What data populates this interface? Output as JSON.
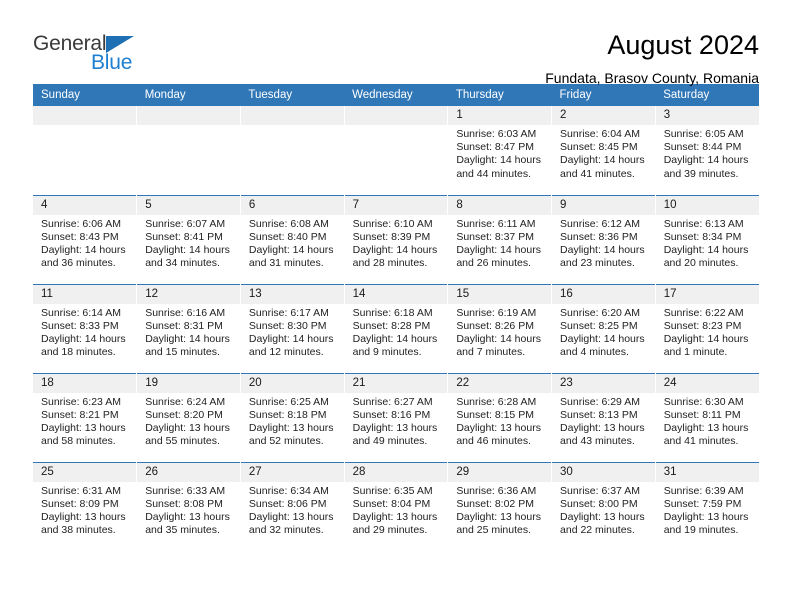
{
  "logo": {
    "word_one": "General",
    "word_two": "Blue",
    "triangle": "blue-triangle-icon",
    "accent_dark": "#3b3b3b",
    "accent_blue": "#1f7fd0"
  },
  "header": {
    "title": "August 2024",
    "subtitle": "Fundata, Brasov County, Romania"
  },
  "theme": {
    "header_band": "#3077b8",
    "daynum_strip": "#f0f0f0",
    "grid_line": "#3077b8",
    "text": "#000000"
  },
  "weekday_headers": [
    "Sunday",
    "Monday",
    "Tuesday",
    "Wednesday",
    "Thursday",
    "Friday",
    "Saturday"
  ],
  "weeks": [
    [
      {
        "day": "",
        "empty": true
      },
      {
        "day": "",
        "empty": true
      },
      {
        "day": "",
        "empty": true
      },
      {
        "day": "",
        "empty": true
      },
      {
        "day": "1",
        "sunrise": "Sunrise: 6:03 AM",
        "sunset": "Sunset: 8:47 PM",
        "daylight_1": "Daylight: 14 hours",
        "daylight_2": "and 44 minutes."
      },
      {
        "day": "2",
        "sunrise": "Sunrise: 6:04 AM",
        "sunset": "Sunset: 8:45 PM",
        "daylight_1": "Daylight: 14 hours",
        "daylight_2": "and 41 minutes."
      },
      {
        "day": "3",
        "sunrise": "Sunrise: 6:05 AM",
        "sunset": "Sunset: 8:44 PM",
        "daylight_1": "Daylight: 14 hours",
        "daylight_2": "and 39 minutes."
      }
    ],
    [
      {
        "day": "4",
        "sunrise": "Sunrise: 6:06 AM",
        "sunset": "Sunset: 8:43 PM",
        "daylight_1": "Daylight: 14 hours",
        "daylight_2": "and 36 minutes."
      },
      {
        "day": "5",
        "sunrise": "Sunrise: 6:07 AM",
        "sunset": "Sunset: 8:41 PM",
        "daylight_1": "Daylight: 14 hours",
        "daylight_2": "and 34 minutes."
      },
      {
        "day": "6",
        "sunrise": "Sunrise: 6:08 AM",
        "sunset": "Sunset: 8:40 PM",
        "daylight_1": "Daylight: 14 hours",
        "daylight_2": "and 31 minutes."
      },
      {
        "day": "7",
        "sunrise": "Sunrise: 6:10 AM",
        "sunset": "Sunset: 8:39 PM",
        "daylight_1": "Daylight: 14 hours",
        "daylight_2": "and 28 minutes."
      },
      {
        "day": "8",
        "sunrise": "Sunrise: 6:11 AM",
        "sunset": "Sunset: 8:37 PM",
        "daylight_1": "Daylight: 14 hours",
        "daylight_2": "and 26 minutes."
      },
      {
        "day": "9",
        "sunrise": "Sunrise: 6:12 AM",
        "sunset": "Sunset: 8:36 PM",
        "daylight_1": "Daylight: 14 hours",
        "daylight_2": "and 23 minutes."
      },
      {
        "day": "10",
        "sunrise": "Sunrise: 6:13 AM",
        "sunset": "Sunset: 8:34 PM",
        "daylight_1": "Daylight: 14 hours",
        "daylight_2": "and 20 minutes."
      }
    ],
    [
      {
        "day": "11",
        "sunrise": "Sunrise: 6:14 AM",
        "sunset": "Sunset: 8:33 PM",
        "daylight_1": "Daylight: 14 hours",
        "daylight_2": "and 18 minutes."
      },
      {
        "day": "12",
        "sunrise": "Sunrise: 6:16 AM",
        "sunset": "Sunset: 8:31 PM",
        "daylight_1": "Daylight: 14 hours",
        "daylight_2": "and 15 minutes."
      },
      {
        "day": "13",
        "sunrise": "Sunrise: 6:17 AM",
        "sunset": "Sunset: 8:30 PM",
        "daylight_1": "Daylight: 14 hours",
        "daylight_2": "and 12 minutes."
      },
      {
        "day": "14",
        "sunrise": "Sunrise: 6:18 AM",
        "sunset": "Sunset: 8:28 PM",
        "daylight_1": "Daylight: 14 hours",
        "daylight_2": "and 9 minutes."
      },
      {
        "day": "15",
        "sunrise": "Sunrise: 6:19 AM",
        "sunset": "Sunset: 8:26 PM",
        "daylight_1": "Daylight: 14 hours",
        "daylight_2": "and 7 minutes."
      },
      {
        "day": "16",
        "sunrise": "Sunrise: 6:20 AM",
        "sunset": "Sunset: 8:25 PM",
        "daylight_1": "Daylight: 14 hours",
        "daylight_2": "and 4 minutes."
      },
      {
        "day": "17",
        "sunrise": "Sunrise: 6:22 AM",
        "sunset": "Sunset: 8:23 PM",
        "daylight_1": "Daylight: 14 hours",
        "daylight_2": "and 1 minute."
      }
    ],
    [
      {
        "day": "18",
        "sunrise": "Sunrise: 6:23 AM",
        "sunset": "Sunset: 8:21 PM",
        "daylight_1": "Daylight: 13 hours",
        "daylight_2": "and 58 minutes."
      },
      {
        "day": "19",
        "sunrise": "Sunrise: 6:24 AM",
        "sunset": "Sunset: 8:20 PM",
        "daylight_1": "Daylight: 13 hours",
        "daylight_2": "and 55 minutes."
      },
      {
        "day": "20",
        "sunrise": "Sunrise: 6:25 AM",
        "sunset": "Sunset: 8:18 PM",
        "daylight_1": "Daylight: 13 hours",
        "daylight_2": "and 52 minutes."
      },
      {
        "day": "21",
        "sunrise": "Sunrise: 6:27 AM",
        "sunset": "Sunset: 8:16 PM",
        "daylight_1": "Daylight: 13 hours",
        "daylight_2": "and 49 minutes."
      },
      {
        "day": "22",
        "sunrise": "Sunrise: 6:28 AM",
        "sunset": "Sunset: 8:15 PM",
        "daylight_1": "Daylight: 13 hours",
        "daylight_2": "and 46 minutes."
      },
      {
        "day": "23",
        "sunrise": "Sunrise: 6:29 AM",
        "sunset": "Sunset: 8:13 PM",
        "daylight_1": "Daylight: 13 hours",
        "daylight_2": "and 43 minutes."
      },
      {
        "day": "24",
        "sunrise": "Sunrise: 6:30 AM",
        "sunset": "Sunset: 8:11 PM",
        "daylight_1": "Daylight: 13 hours",
        "daylight_2": "and 41 minutes."
      }
    ],
    [
      {
        "day": "25",
        "sunrise": "Sunrise: 6:31 AM",
        "sunset": "Sunset: 8:09 PM",
        "daylight_1": "Daylight: 13 hours",
        "daylight_2": "and 38 minutes."
      },
      {
        "day": "26",
        "sunrise": "Sunrise: 6:33 AM",
        "sunset": "Sunset: 8:08 PM",
        "daylight_1": "Daylight: 13 hours",
        "daylight_2": "and 35 minutes."
      },
      {
        "day": "27",
        "sunrise": "Sunrise: 6:34 AM",
        "sunset": "Sunset: 8:06 PM",
        "daylight_1": "Daylight: 13 hours",
        "daylight_2": "and 32 minutes."
      },
      {
        "day": "28",
        "sunrise": "Sunrise: 6:35 AM",
        "sunset": "Sunset: 8:04 PM",
        "daylight_1": "Daylight: 13 hours",
        "daylight_2": "and 29 minutes."
      },
      {
        "day": "29",
        "sunrise": "Sunrise: 6:36 AM",
        "sunset": "Sunset: 8:02 PM",
        "daylight_1": "Daylight: 13 hours",
        "daylight_2": "and 25 minutes."
      },
      {
        "day": "30",
        "sunrise": "Sunrise: 6:37 AM",
        "sunset": "Sunset: 8:00 PM",
        "daylight_1": "Daylight: 13 hours",
        "daylight_2": "and 22 minutes."
      },
      {
        "day": "31",
        "sunrise": "Sunrise: 6:39 AM",
        "sunset": "Sunset: 7:59 PM",
        "daylight_1": "Daylight: 13 hours",
        "daylight_2": "and 19 minutes."
      }
    ]
  ]
}
